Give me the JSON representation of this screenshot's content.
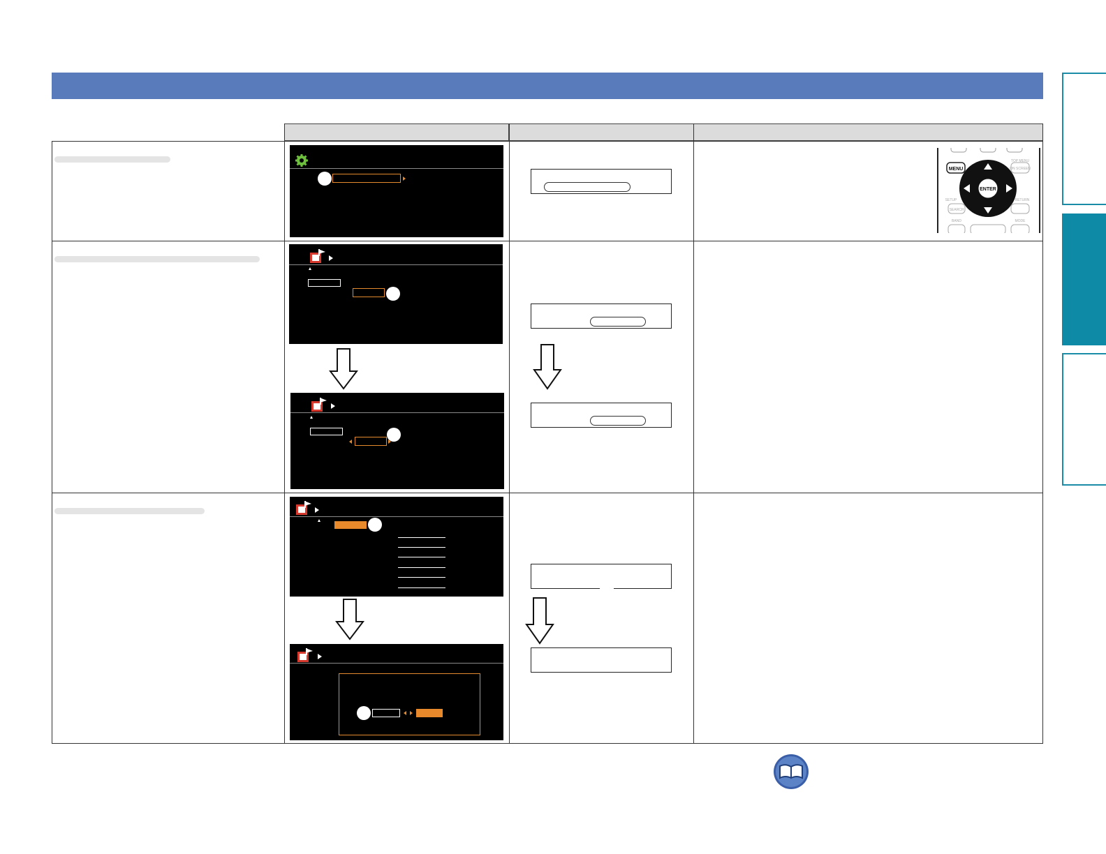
{
  "header": {
    "banner_color": "#5a7bbb"
  },
  "table": {
    "columns": [
      "",
      "",
      ""
    ],
    "rows": [
      {
        "id": "row1",
        "label": ""
      },
      {
        "id": "row2",
        "label": ""
      },
      {
        "id": "row3",
        "label": ""
      }
    ]
  },
  "remote": {
    "menu_label": "MENU",
    "enter_label": "ENTER",
    "top_menu_label": "TOP MENU",
    "on_screen_label": "ON SCREEN",
    "setup_label": "SETUP",
    "return_label": "RETURN",
    "search_label": "SEARCH",
    "band_label": "BAND",
    "mode_label": "MODE"
  },
  "side_tabs": {
    "active_color": "#0e8aa6",
    "outline_color": "#1a8ca8"
  },
  "icons": [
    "gear-icon",
    "music-video-icon",
    "book-icon",
    "down-arrow-icon"
  ],
  "colors": {
    "osd_bg": "#000000",
    "highlight": "#e8892b"
  }
}
